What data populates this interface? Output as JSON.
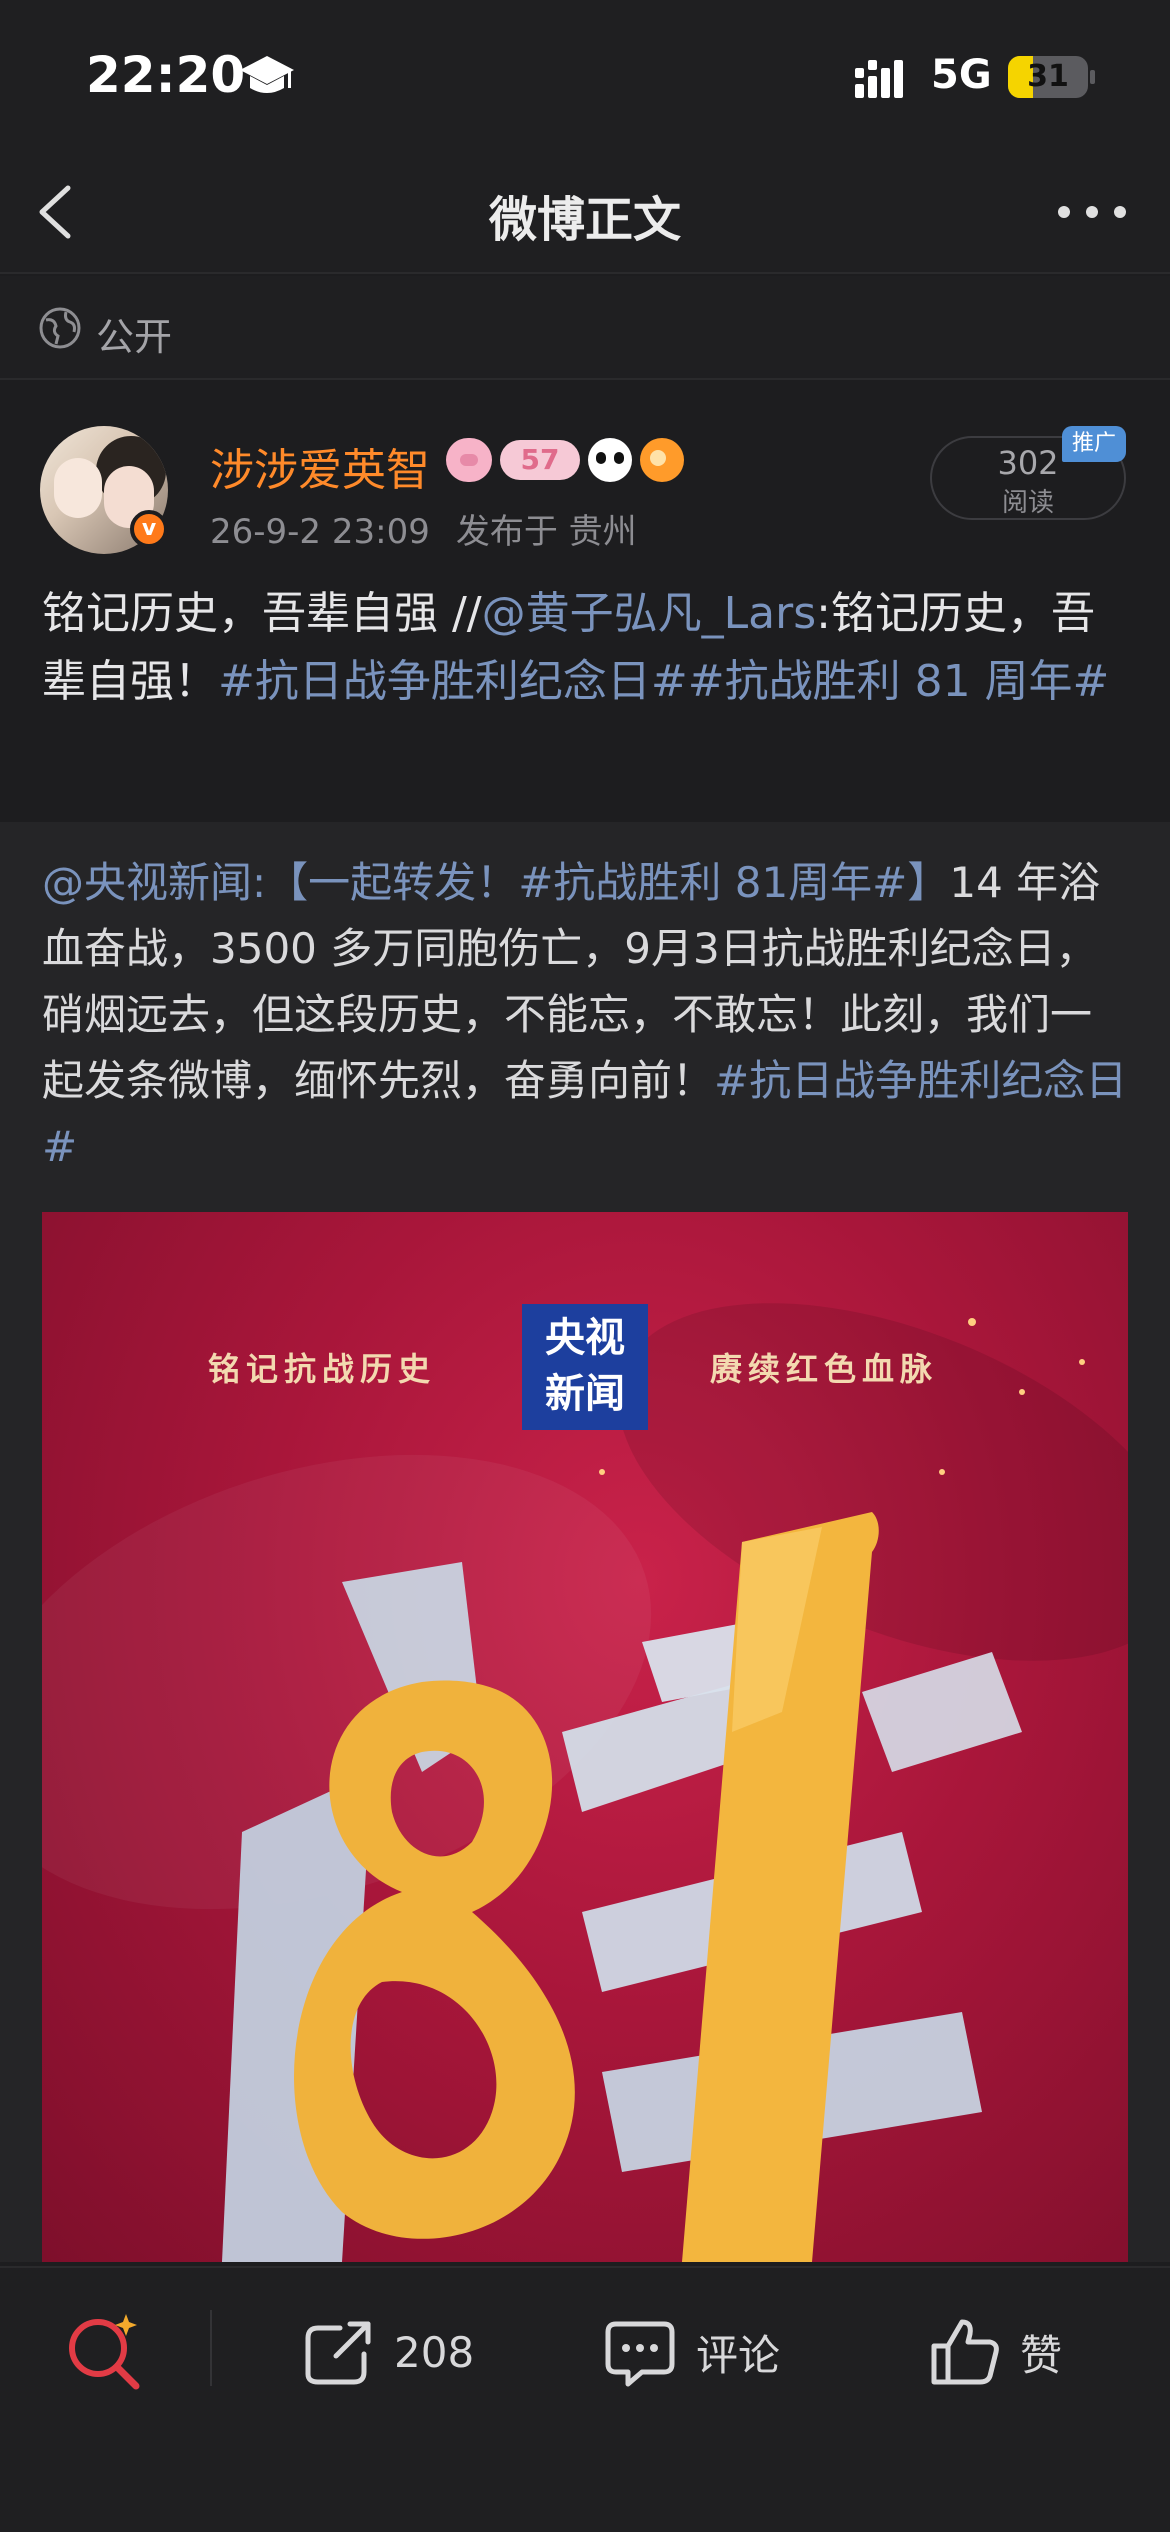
{
  "status_bar": {
    "time": "22:20",
    "network": "5G",
    "battery": "31",
    "battery_level_percent": 31
  },
  "nav": {
    "title": "微博正文"
  },
  "visibility": {
    "label": "公开"
  },
  "post": {
    "username": "涉涉爱英智",
    "badges": [
      "pig-badge-icon",
      "57",
      "panda-badge-icon",
      "fish-badge-icon"
    ],
    "badge_text": "57",
    "date": "26-9-2 23:09",
    "location": "发布于 贵州",
    "reads_count": "302",
    "reads_label": "阅读",
    "promo_tag": "推广",
    "text_part1": "铭记历史，吾辈自强 //",
    "mention": "@黄子弘凡_Lars",
    "text_part2": ":铭记历史，吾辈自强！",
    "hashtag1": "#抗日战争胜利纪念日#",
    "hashtag2": "#抗战胜利 81 周年#"
  },
  "repost": {
    "mention": "@央视新闻",
    "colon": ":",
    "bracket_open": "【一起转发！",
    "hashtag_in_bracket": "#抗战胜利 81周年#",
    "bracket_close": "】",
    "body": "14 年浴血奋战，3500 多万同胞伤亡，9月3日抗战胜利纪念日，硝烟远去，但这段历史，不能忘，不敢忘！此刻，我们一起发条微博，缅怀先烈，奋勇向前！",
    "hashtag_end": "#抗日战争胜利纪念日#",
    "poster": {
      "left_text": "铭记抗战历史",
      "right_text": "赓续红色血脉",
      "logo_line1": "央视",
      "logo_line2": "新闻"
    }
  },
  "bottom_bar": {
    "share_count": "208",
    "comment_label": "评论",
    "like_label": "赞"
  },
  "colors": {
    "accent_orange": "#ff8a2a",
    "link_blue": "#7a93bd",
    "promo_blue": "#4f8fd6",
    "poster_red": "#a8163a",
    "battery_yellow": "#f5d400"
  }
}
